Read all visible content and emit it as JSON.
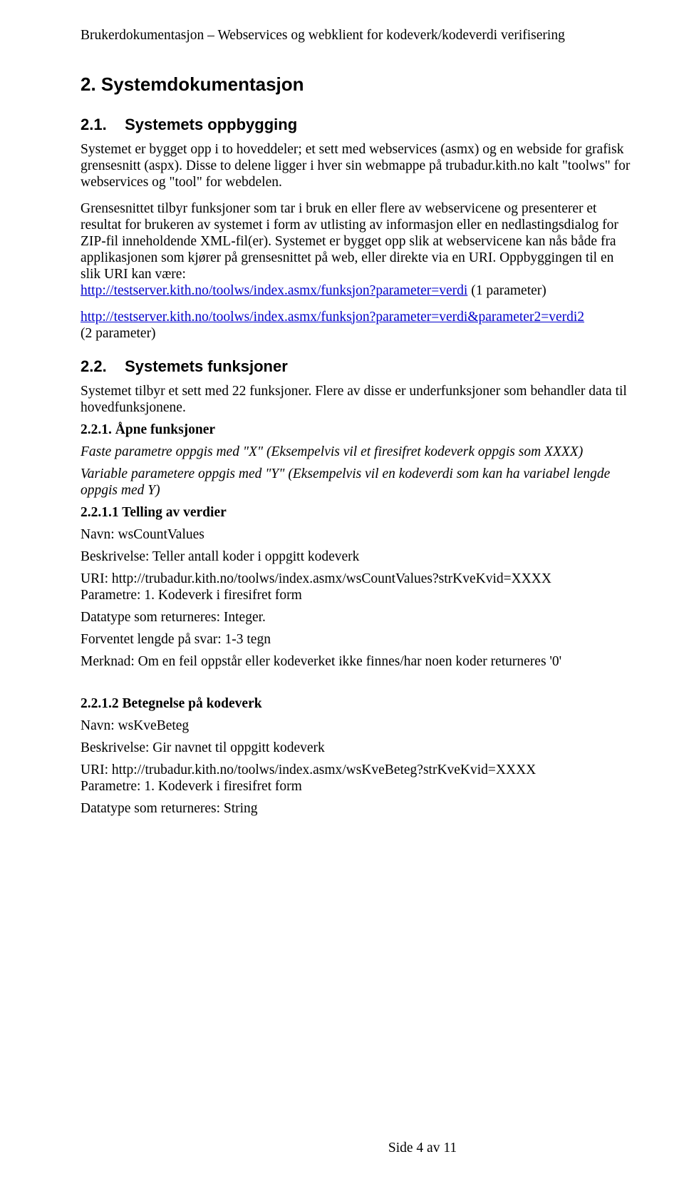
{
  "header": "Brukerdokumentasjon – Webservices og webklient for kodeverk/kodeverdi verifisering",
  "h1": "2. Systemdokumentasjon",
  "s21": {
    "num": "2.1.",
    "title": "Systemets oppbygging",
    "p1": "Systemet er bygget opp i to hoveddeler; et sett med webservices (asmx) og en webside for grafisk grensesnitt (aspx). Disse to delene ligger i hver sin webmappe på trubadur.kith.no kalt \"toolws\" for webservices og \"tool\" for webdelen.",
    "p2a": "Grensesnittet tilbyr funksjoner som tar i bruk en eller flere av webservicene og presenterer et resultat for brukeren av systemet i form av utlisting av informasjon eller en nedlastingsdialog for ZIP-fil inneholdende XML-fil(er). Systemet er bygget opp slik at webservicene kan nås både fra applikasjonen som kjører på grensesnittet på web, eller direkte via en URI. Oppbyggingen til en slik URI kan være: ",
    "link1": "http://testserver.kith.no/toolws/index.asmx/funksjon?parameter=verdi",
    "p2b": " (1 parameter)",
    "link2": "http://testserver.kith.no/toolws/index.asmx/funksjon?parameter=verdi&parameter2=verdi2",
    "p3b": "(2 parameter)"
  },
  "s22": {
    "num": "2.2.",
    "title": "Systemets funksjoner",
    "p1": "Systemet tilbyr et sett med 22 funksjoner. Flere av disse er underfunksjoner som behandler data til hovedfunksjonene."
  },
  "s221": {
    "title": "2.2.1.  Åpne funksjoner",
    "p1": "Faste parametre oppgis med \"X\" (Eksempelvis vil et firesifret kodeverk oppgis som XXXX)",
    "p2": "Variable parametere oppgis med \"Y\" (Eksempelvis vil en kodeverdi som kan ha variabel lengde oppgis med Y)"
  },
  "s2211": {
    "title": "2.2.1.1  Telling av verdier",
    "name": "Navn: wsCountValues",
    "desc": "Beskrivelse: Teller antall koder i oppgitt kodeverk",
    "uri": "URI: http://trubadur.kith.no/toolws/index.asmx/wsCountValues?strKveKvid=XXXX",
    "param": "Parametre: 1. Kodeverk i firesifret form",
    "dtype": "Datatype som returneres: Integer.",
    "len": "Forventet lengde på svar: 1-3 tegn",
    "note": "Merknad: Om en feil oppstår eller kodeverket ikke finnes/har noen koder returneres '0'"
  },
  "s2212": {
    "title": "2.2.1.2  Betegnelse på kodeverk",
    "name": "Navn: wsKveBeteg",
    "desc": "Beskrivelse: Gir navnet til oppgitt kodeverk",
    "uri": "URI: http://trubadur.kith.no/toolws/index.asmx/wsKveBeteg?strKveKvid=XXXX",
    "param": "Parametre: 1. Kodeverk i firesifret form",
    "dtype": "Datatype som returneres: String"
  },
  "footer": "Side 4 av 11"
}
